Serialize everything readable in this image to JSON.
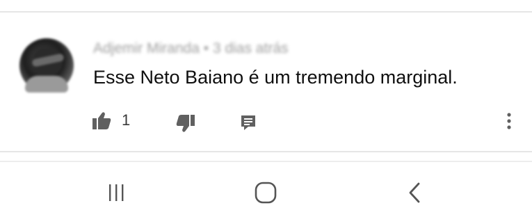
{
  "comment": {
    "author": "Adjemir Miranda",
    "separator": "•",
    "time_ago": "3 dias atrás",
    "text": "Esse Neto Baiano é um tremendo marginal.",
    "likes": "1"
  },
  "icons": {
    "like": "thumbs-up-icon",
    "dislike": "thumbs-down-icon",
    "reply": "comment-reply-icon",
    "more": "more-vertical-icon",
    "nav_recent": "recent-apps-icon",
    "nav_home": "home-icon",
    "nav_back": "back-icon"
  },
  "colors": {
    "text": "#0f0f0f",
    "icon": "#606060",
    "divider": "#e6e6e6",
    "meta": "#9e9e9e"
  }
}
